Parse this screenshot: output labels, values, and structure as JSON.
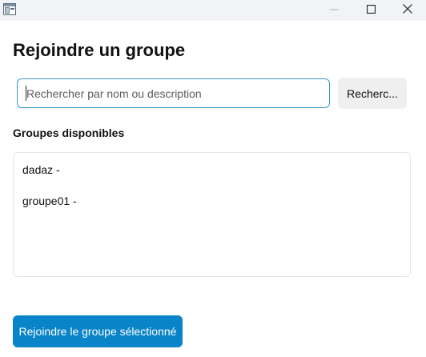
{
  "window": {
    "icons": {
      "app": "app-window-icon",
      "minimize": "minimize-icon",
      "maximize": "maximize-icon",
      "close": "close-icon"
    }
  },
  "main": {
    "title": "Rejoindre un groupe",
    "search": {
      "value": "",
      "placeholder": "Rechercher par nom ou description",
      "button_label": "Recherc..."
    },
    "available_label": "Groupes disponibles",
    "groups": [
      {
        "label": "dadaz -"
      },
      {
        "label": "groupe01 -"
      }
    ],
    "join_button_label": "Rejoindre le groupe sélectionné"
  },
  "colors": {
    "accent": "#0a84c8",
    "focus_border": "#3a98c9",
    "titlebar_bg": "#f1f3f6",
    "secondary_button_bg": "#efefef"
  }
}
